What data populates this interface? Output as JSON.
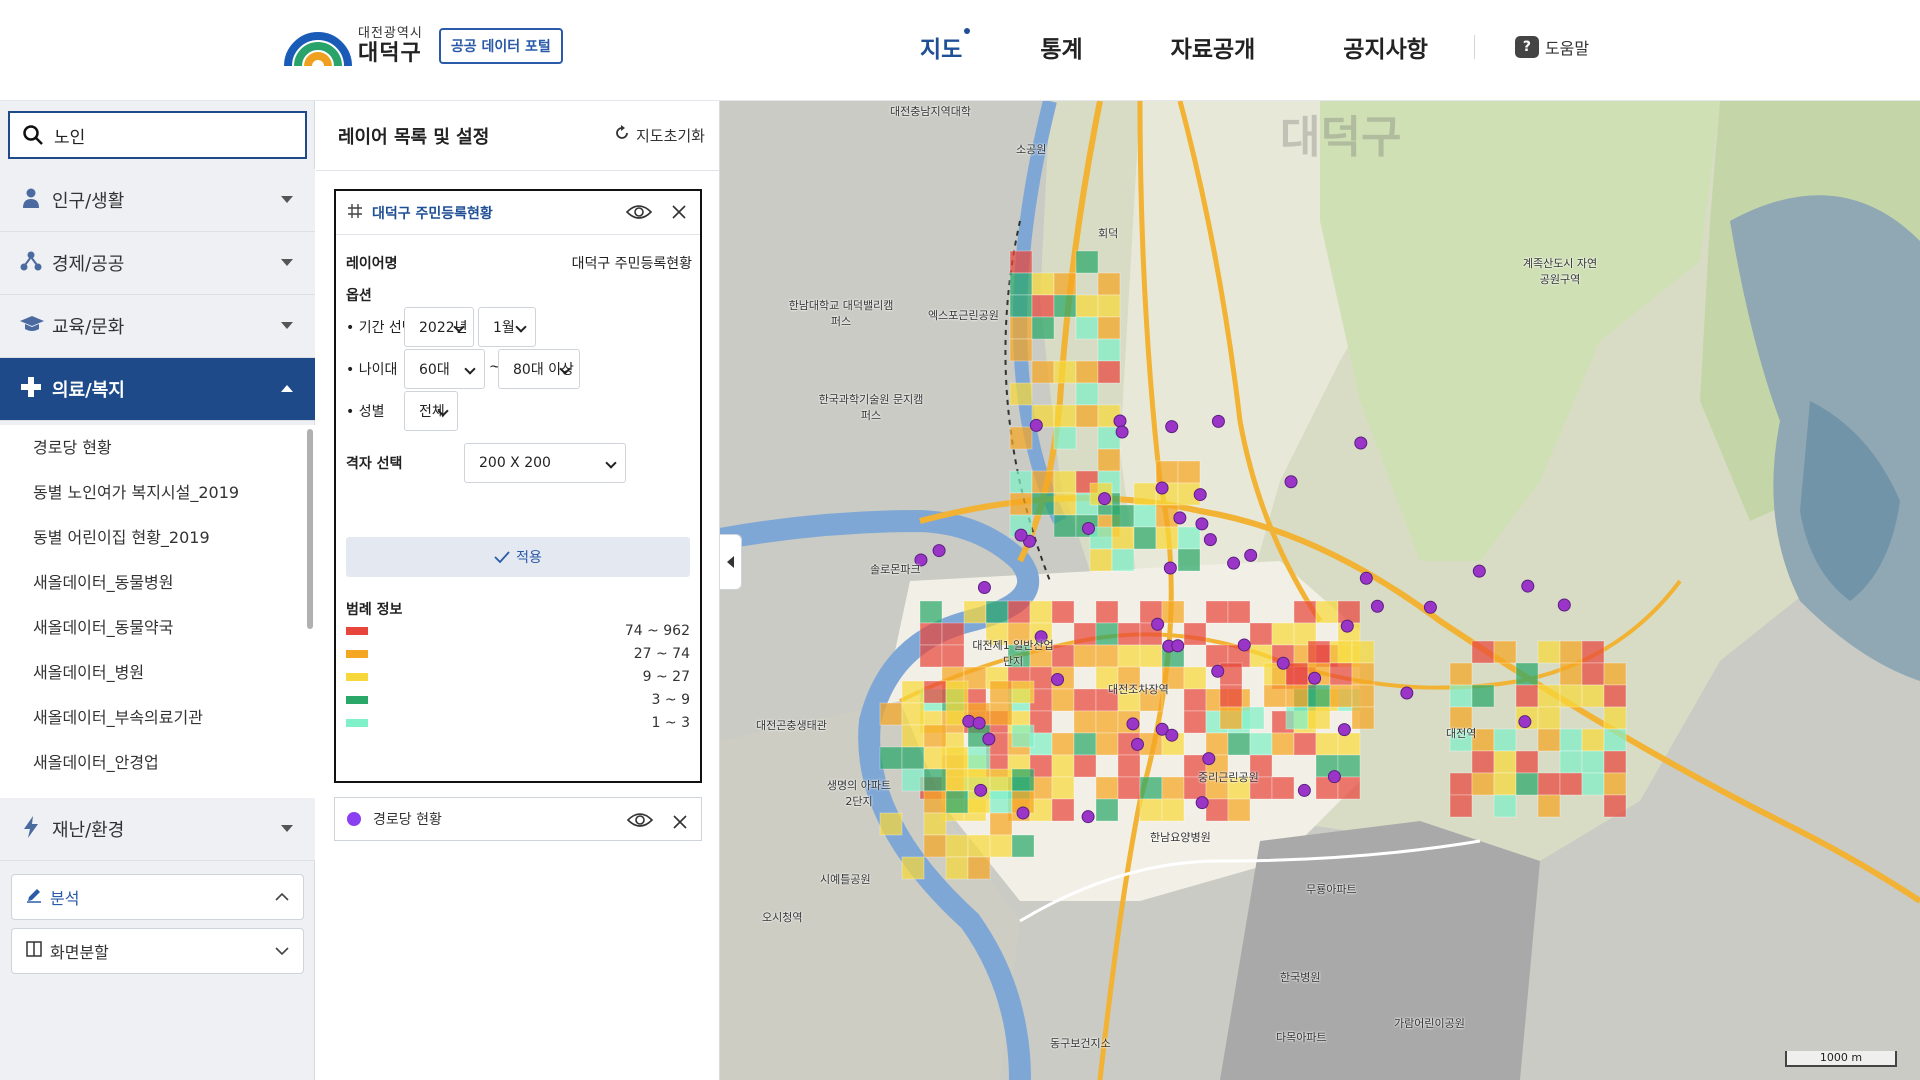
{
  "header": {
    "logo_sub": "대전광역시",
    "logo_main": "대덕구",
    "portal_badge": "공공 데이터 포털",
    "nav": [
      "지도",
      "통계",
      "자료공개",
      "공지사항"
    ],
    "help": "도움말"
  },
  "search": {
    "value": "노인"
  },
  "menu": {
    "categories": [
      "인구/생활",
      "경제/공공",
      "교육/문화",
      "의료/복지",
      "재난/환경"
    ],
    "active": "의료/복지",
    "sub_items": [
      "경로당 현황",
      "동별 노인여가 복지시설_2019",
      "동별 어린이집 현황_2019",
      "새올데이터_동물병원",
      "새올데이터_동물약국",
      "새올데이터_병원",
      "새올데이터_부속의료기관",
      "새올데이터_안경업"
    ],
    "tools": [
      "분석",
      "화면분할"
    ]
  },
  "panel": {
    "title": "레이어 목록 및 설정",
    "reset": "지도초기화",
    "layer": {
      "title": "대덕구 주민등록현황",
      "name_label": "레이어명",
      "name_value": "대덕구 주민등록현황",
      "options_label": "옵션",
      "period_label": "• 기간 선택",
      "year": "2022년",
      "month": "1월",
      "age_label": "• 나이대",
      "age_from": "60대",
      "age_sep": "~",
      "age_to": "80대 이상",
      "gender_label": "• 성별",
      "gender": "전체",
      "grid_label": "격자 선택",
      "grid": "200 X 200",
      "apply": "적용",
      "legend_label": "범례 정보",
      "legend": [
        {
          "color": "#e8463c",
          "range": "74 ~ 962"
        },
        {
          "color": "#f5a623",
          "range": "27 ~ 74"
        },
        {
          "color": "#f7d83a",
          "range": "9 ~ 27"
        },
        {
          "color": "#2aa86a",
          "range": "3 ~ 9"
        },
        {
          "color": "#7ff0c8",
          "range": "1 ~ 3"
        }
      ]
    },
    "layer2": {
      "title": "경로당 현황"
    }
  },
  "map": {
    "labels": [
      "대덕구",
      "대전충남지역대학",
      "소공원",
      "회덕",
      "한남대학교 대덕밸리캠퍼스",
      "엑스포근린공원",
      "한국과학기술원 문지캠퍼스",
      "계족산도시 자연공원구역",
      "솔로몬파크",
      "대전제1 일반산업단지",
      "대전조차장역",
      "대전곤충생태관",
      "생명의 아파트2단지",
      "시예틀공원",
      "오시청역",
      "대전역",
      "한남요양병원",
      "중리근린공원",
      "무룡아파트",
      "한국병원",
      "동구보건지소",
      "가람어린이공원",
      "다목아파트"
    ],
    "scale": "1000 m"
  }
}
